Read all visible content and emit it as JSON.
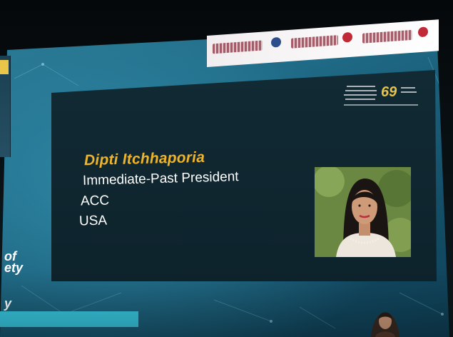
{
  "slide": {
    "speaker_name": "Dipti Itchhaporia",
    "speaker_lines": [
      "Immediate-Past President",
      "ACC",
      "USA"
    ],
    "badge_number": "69"
  },
  "side_panel": {
    "fragments": [
      "of",
      "ety",
      "y"
    ]
  },
  "colors": {
    "screen_blue": "#1f6a86",
    "slide_dark": "#112a34",
    "name_gold": "#f0b429",
    "accent_cyan": "#37c6e0",
    "logo_red": "#c02a38"
  }
}
